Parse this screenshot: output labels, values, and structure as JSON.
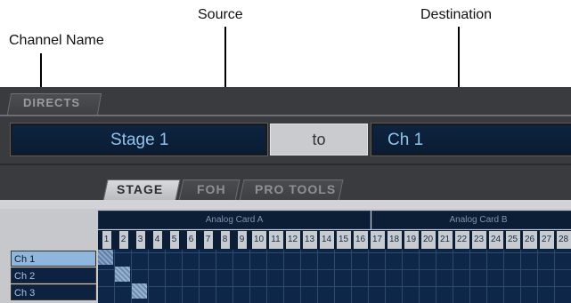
{
  "callouts": {
    "source": "Source",
    "destination": "Destination",
    "channel_name": "Channel Name"
  },
  "window": {
    "section_tab": "DIRECTS",
    "source_value": "Stage 1",
    "to_label": "to",
    "destination_value": "Ch 1"
  },
  "tabs": [
    {
      "label": "STAGE",
      "active": true
    },
    {
      "label": "FOH",
      "active": false
    },
    {
      "label": "PRO TOOLS",
      "active": false
    }
  ],
  "matrix": {
    "card_a": "Analog Card A",
    "card_b": "Analog Card B",
    "columns": [
      "1",
      "2",
      "3",
      "4",
      "5",
      "6",
      "7",
      "8",
      "9",
      "10",
      "11",
      "12",
      "13",
      "14",
      "15",
      "16",
      "17",
      "18",
      "19",
      "20",
      "21",
      "22",
      "23",
      "24",
      "25",
      "26",
      "27",
      "28"
    ],
    "channels": [
      {
        "label": "Ch 1",
        "selected": true
      },
      {
        "label": "Ch 2",
        "selected": false
      },
      {
        "label": "Ch 3",
        "selected": false
      }
    ]
  },
  "colors": {
    "window_bg": "#3a3b3e",
    "field_bg": "#0d2440",
    "field_text": "#8fc3ee",
    "grid_bg": "#0e2748"
  }
}
